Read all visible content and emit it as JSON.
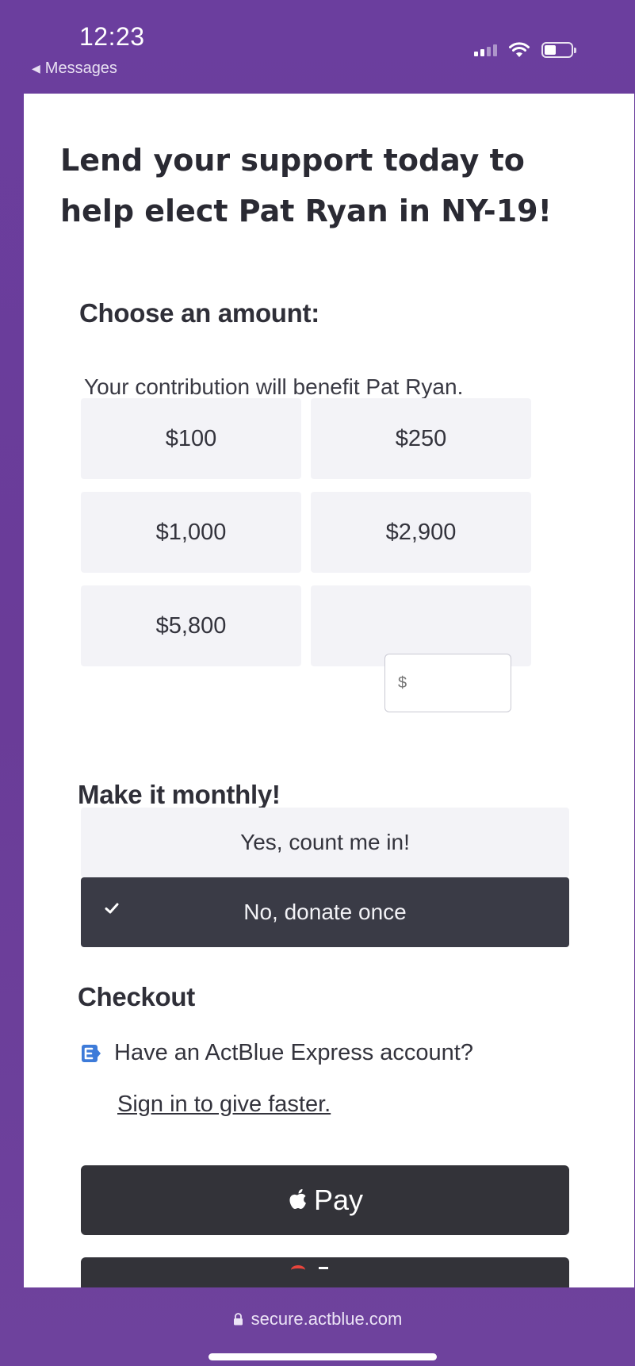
{
  "status_bar": {
    "time": "12:23",
    "back_label": "Messages"
  },
  "page": {
    "headline": "Lend your support today to help elect Pat Ryan in NY-19!",
    "amount_section": {
      "title": "Choose an amount:",
      "subtitle": "Your contribution will benefit Pat Ryan.",
      "amounts": [
        "$100",
        "$250",
        "$1,000",
        "$2,900",
        "$5,800"
      ],
      "custom_placeholder": "$"
    },
    "monthly_section": {
      "title": "Make it monthly!",
      "yes_label": "Yes, count me in!",
      "no_label": "No, donate once",
      "selected": "no"
    },
    "checkout_section": {
      "title": "Checkout",
      "express_prompt": "Have an ActBlue Express account?",
      "sign_in_link": "Sign in to give faster.",
      "apple_pay_label": "Pay"
    }
  },
  "bottom_bar": {
    "url": "secure.actblue.com"
  },
  "colors": {
    "frame_purple": "#6a3f9a",
    "selected_dark": "#3a3b46",
    "option_bg": "#f3f3f7",
    "express_blue": "#3d7bd9"
  },
  "icons": [
    "back-arrow-icon",
    "signal-icon",
    "wifi-icon",
    "battery-icon",
    "check-icon",
    "actblue-express-icon",
    "apple-logo-icon",
    "lock-icon"
  ]
}
